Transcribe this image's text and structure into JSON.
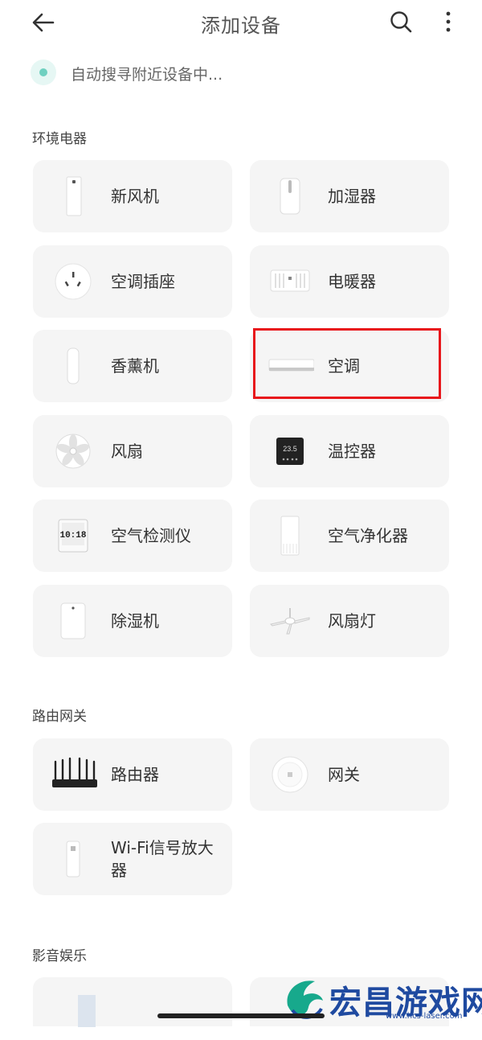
{
  "header": {
    "title": "添加设备"
  },
  "scan": {
    "text": "自动搜寻附近设备中..."
  },
  "sections": {
    "env": {
      "title": "环境电器",
      "items": [
        {
          "label": "新风机"
        },
        {
          "label": "加湿器"
        },
        {
          "label": "空调插座"
        },
        {
          "label": "电暖器"
        },
        {
          "label": "香薰机"
        },
        {
          "label": "空调"
        },
        {
          "label": "风扇"
        },
        {
          "label": "温控器"
        },
        {
          "label": "空气检测仪"
        },
        {
          "label": "空气净化器"
        },
        {
          "label": "除湿机"
        },
        {
          "label": "风扇灯"
        }
      ]
    },
    "router": {
      "title": "路由网关",
      "items": [
        {
          "label": "路由器"
        },
        {
          "label": "网关"
        },
        {
          "label": "Wi-Fi信号放大器"
        }
      ]
    },
    "media": {
      "title": "影音娱乐"
    }
  },
  "device_readouts": {
    "thermostat": "23.5",
    "air_monitor": "10:18"
  },
  "watermark": {
    "text": "宏昌游戏网",
    "url": "www.hcs-laser.com"
  },
  "colors": {
    "accent_teal": "#6fd0c0",
    "highlight_red": "#e8161b",
    "card_bg": "#f5f5f5"
  }
}
